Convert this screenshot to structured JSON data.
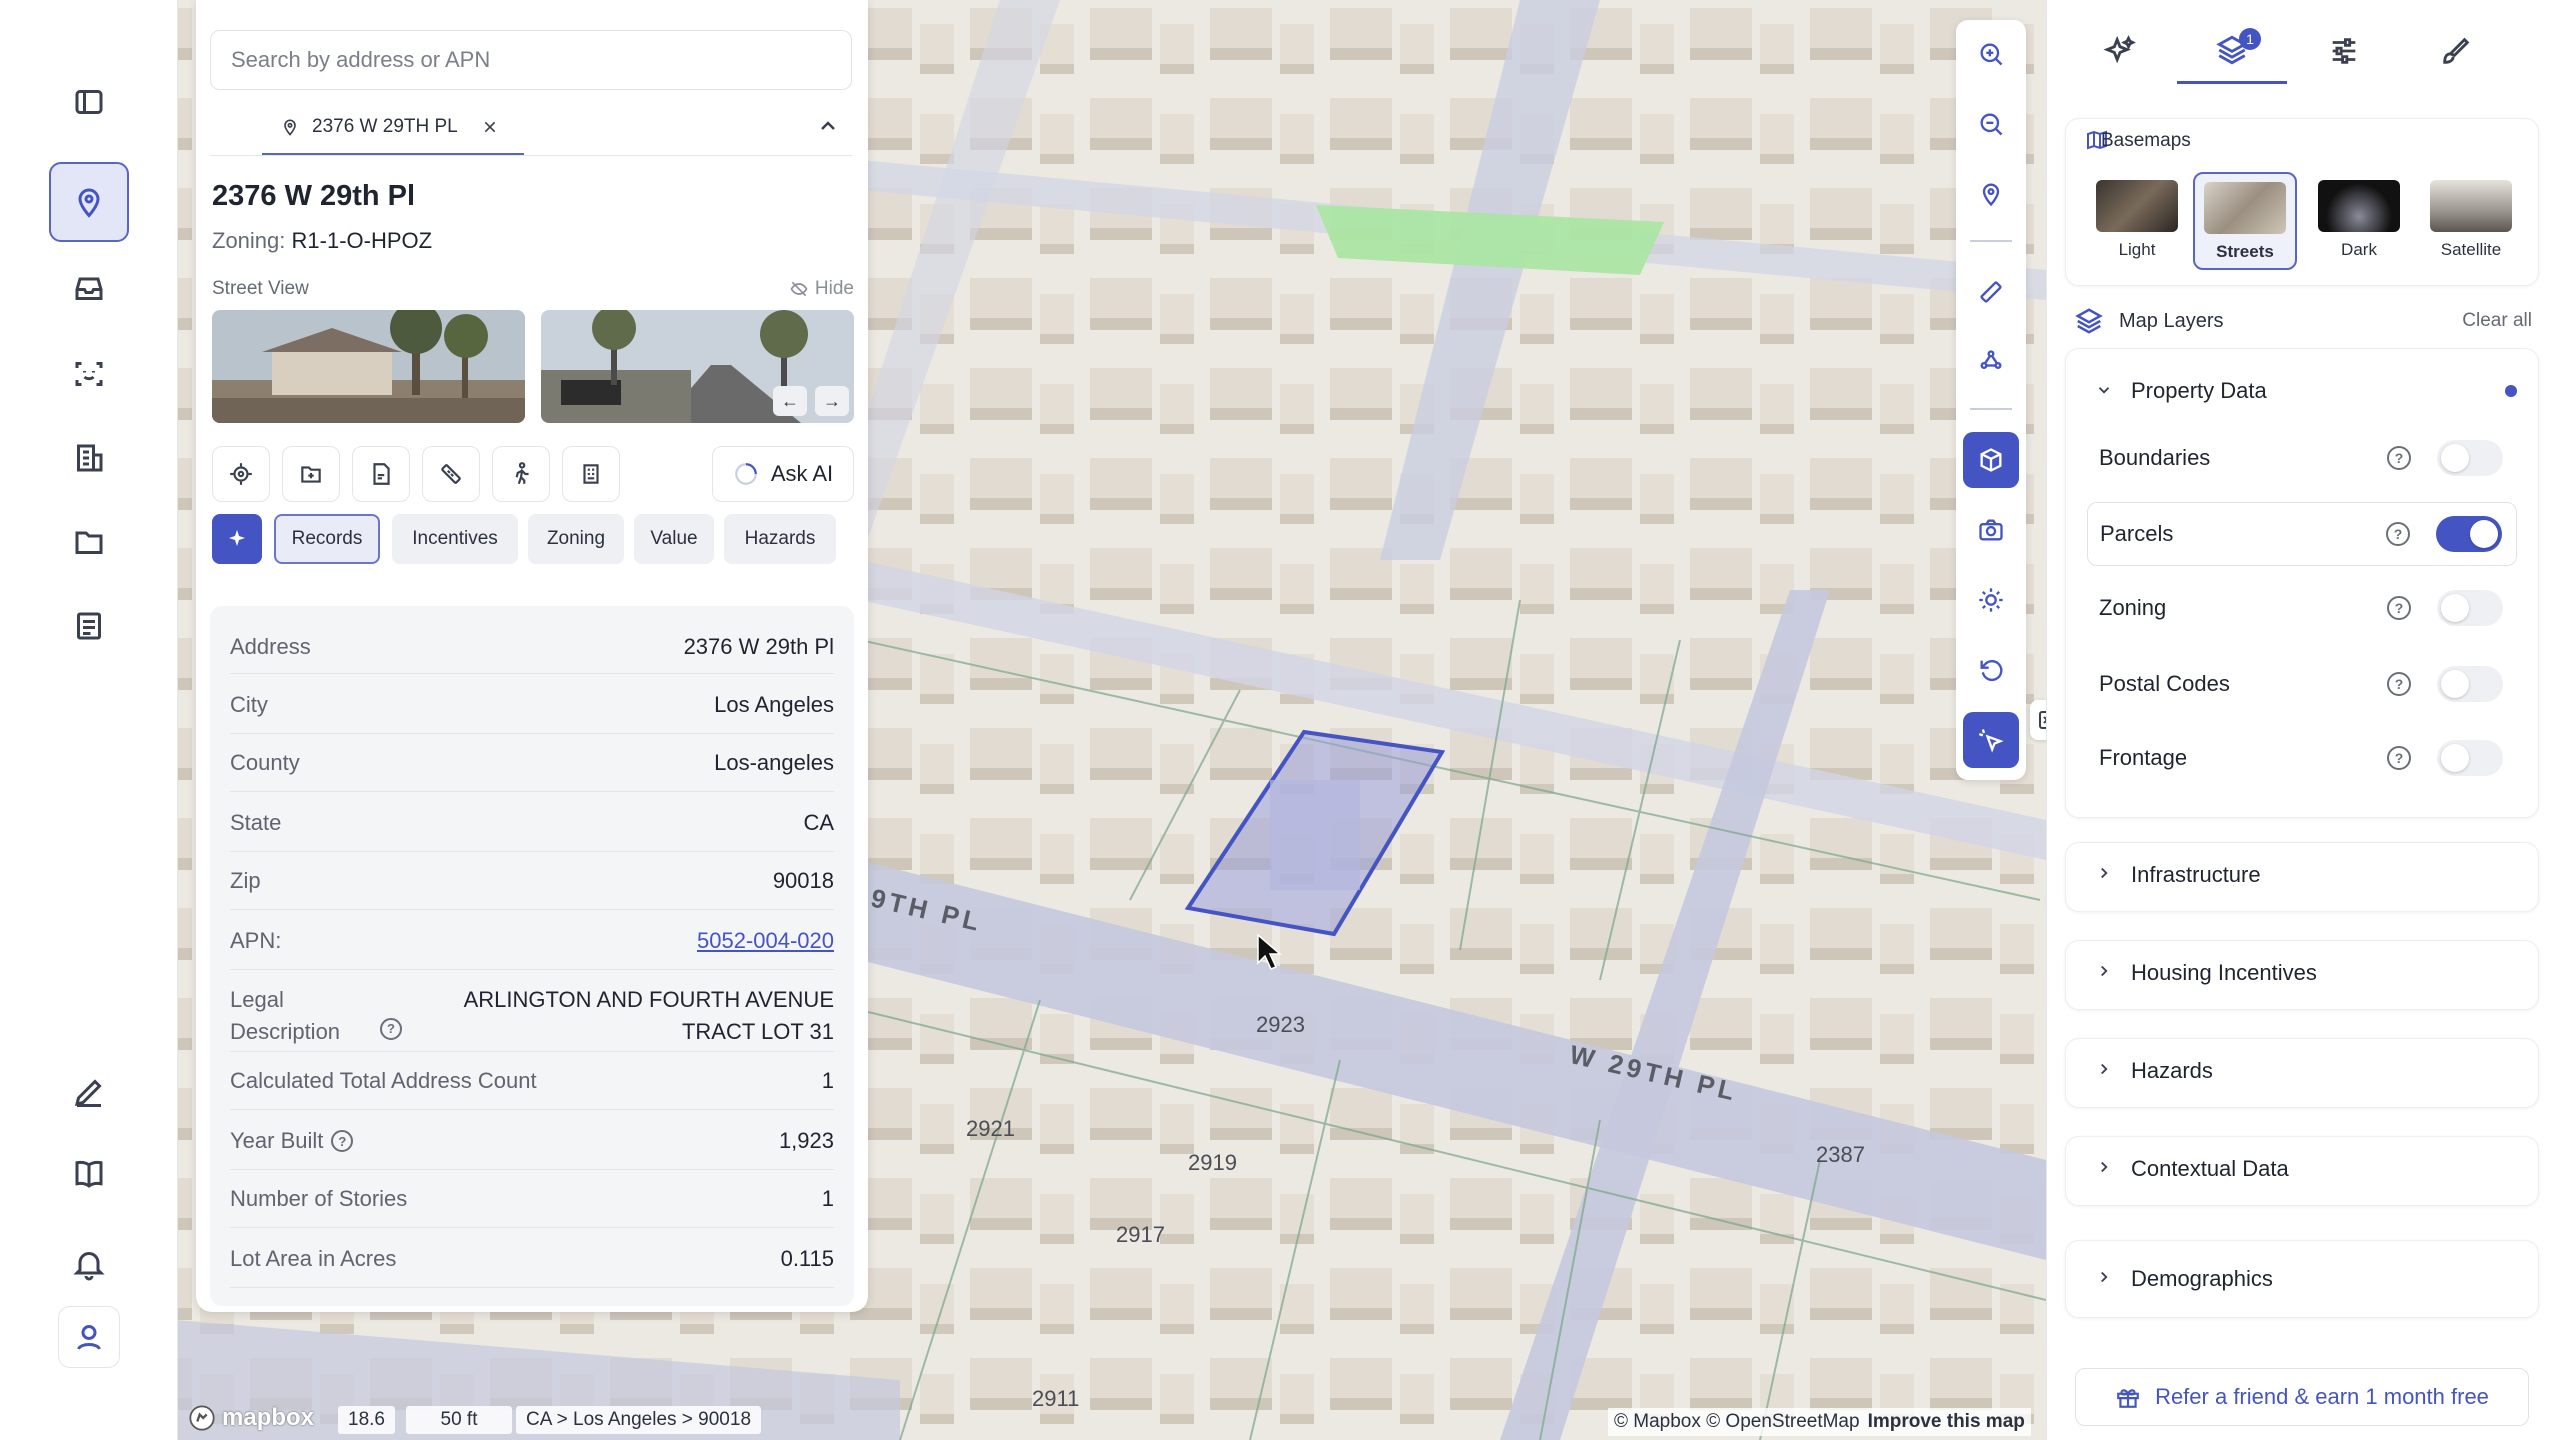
{
  "search": {
    "placeholder": "Search by address or APN"
  },
  "address_tab": {
    "label": "2376 W 29TH PL"
  },
  "property": {
    "title": "2376 W 29th Pl",
    "zoning_label": "Zoning:",
    "zoning_value": "R1-1-O-HPOZ",
    "street_view_label": "Street View",
    "hide_label": "Hide"
  },
  "ask_ai": "Ask AI",
  "chips": [
    "Records",
    "Incentives",
    "Zoning",
    "Value",
    "Hazards"
  ],
  "records": [
    {
      "k": "Address",
      "v": "2376 W 29th Pl"
    },
    {
      "k": "City",
      "v": "Los Angeles"
    },
    {
      "k": "County",
      "v": "Los-angeles"
    },
    {
      "k": "State",
      "v": "CA"
    },
    {
      "k": "Zip",
      "v": "90018"
    },
    {
      "k": "APN:",
      "v": "5052-004-020"
    },
    {
      "k": "Legal Description",
      "v": "ARLINGTON AND FOURTH AVENUE TRACT LOT 31"
    },
    {
      "k": "Calculated Total Address Count",
      "v": "1"
    },
    {
      "k": "Year Built",
      "v": "1,923"
    },
    {
      "k": "Number of Stories",
      "v": "1"
    },
    {
      "k": "Lot Area in Acres",
      "v": "0.115"
    }
  ],
  "map": {
    "street_name": "W 29TH PL",
    "street_name_partial": "9TH PL",
    "parcel_numbers": [
      "2923",
      "2921",
      "2919",
      "2917",
      "2911",
      "2387"
    ]
  },
  "right_panel": {
    "layers_badge": "1",
    "basemaps_title": "Basemaps",
    "basemaps": [
      {
        "label": "Light",
        "selected": false
      },
      {
        "label": "Streets",
        "selected": true
      },
      {
        "label": "Dark",
        "selected": false
      },
      {
        "label": "Satellite",
        "selected": false
      }
    ],
    "map_layers_title": "Map Layers",
    "clear_all": "Clear all",
    "property_data": {
      "title": "Property Data",
      "layers": [
        {
          "name": "Boundaries",
          "on": false
        },
        {
          "name": "Parcels",
          "on": true
        },
        {
          "name": "Zoning",
          "on": false
        },
        {
          "name": "Postal Codes",
          "on": false
        },
        {
          "name": "Frontage",
          "on": false
        }
      ]
    },
    "sections": [
      "Infrastructure",
      "Housing Incentives",
      "Hazards",
      "Contextual Data",
      "Demographics"
    ],
    "refer": "Refer a friend & earn 1 month free"
  },
  "bottom_bar": {
    "logo": "mapbox",
    "zoom": "18.6",
    "scale": "50 ft",
    "breadcrumb": "CA > Los Angeles > 90018",
    "attribution": "© Mapbox © OpenStreetMap",
    "improve": "Improve this map"
  },
  "colors": {
    "accent": "#4454c3",
    "parcel_highlight": "#8f96d6",
    "park": "#a8e6a1",
    "road": "#c5c9de"
  }
}
